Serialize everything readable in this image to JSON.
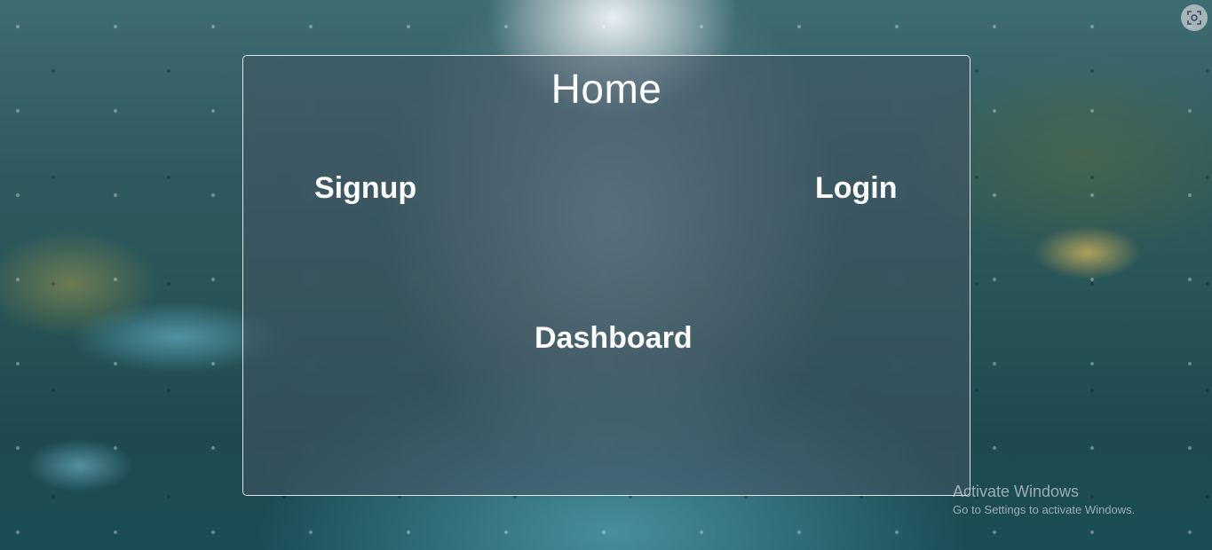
{
  "page": {
    "title": "Home"
  },
  "nav": {
    "signup": "Signup",
    "login": "Login",
    "dashboard": "Dashboard"
  },
  "corner_button": {
    "icon": "screen-capture-icon"
  },
  "watermark": {
    "title": "Activate Windows",
    "subtitle": "Go to Settings to activate Windows."
  },
  "colors": {
    "text": "#ffffff",
    "panel_border": "#ffffff",
    "panel_fill": "#465564",
    "background": "#2f5b60"
  }
}
